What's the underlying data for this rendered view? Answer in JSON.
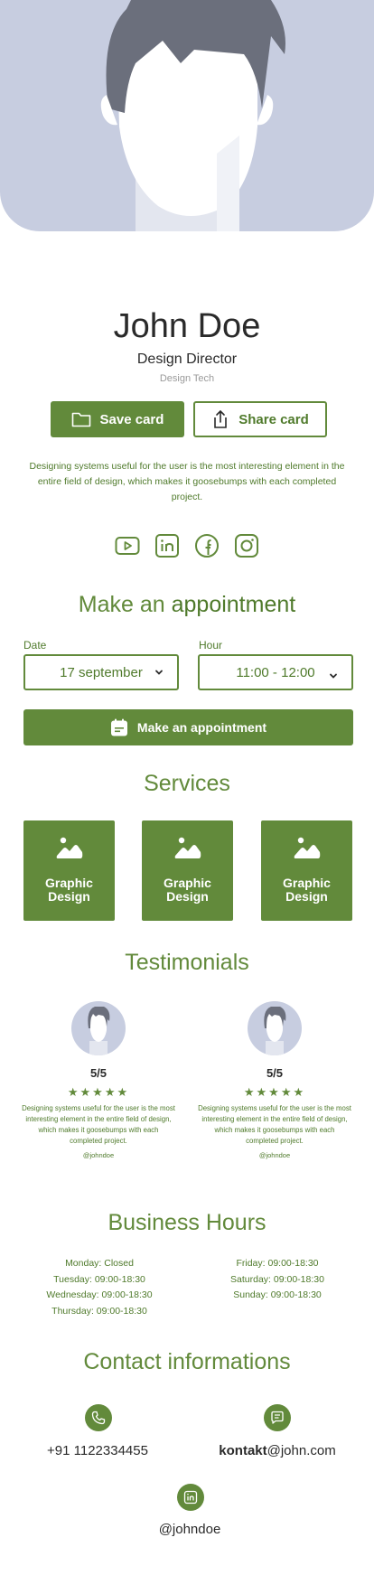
{
  "profile": {
    "name": "John Doe",
    "role": "Design Director",
    "company": "Design Tech",
    "bio": "Designing systems useful for the user is the most interesting element in the entire field of design, which makes it goosebumps with each completed project."
  },
  "actions": {
    "save_label": "Save card",
    "share_label": "Share card"
  },
  "socials": [
    "youtube-icon",
    "linkedin-icon",
    "facebook-icon",
    "instagram-icon"
  ],
  "appointment": {
    "heading_light": "Make an",
    "heading_bold": "appointment",
    "date_label": "Date",
    "date_value": "17 september",
    "hour_label": "Hour",
    "hour_value": "11:00 - 12:00",
    "button_label": "Make an appointment"
  },
  "services": {
    "heading": "Services",
    "items": [
      {
        "line1": "Graphic",
        "line2": "Design"
      },
      {
        "line1": "Graphic",
        "line2": "Design"
      },
      {
        "line1": "Graphic",
        "line2": "Design"
      }
    ]
  },
  "testimonials": {
    "heading": "Testimonials",
    "items": [
      {
        "score": "5/5",
        "stars": "★★★★★",
        "rating": 5,
        "text": "Designing systems useful for the user is the most interesting element in the entire field of design, which makes it goosebumps with each completed project.",
        "handle": "@johndoe"
      },
      {
        "score": "5/5",
        "stars": "★★★★★",
        "rating": 5,
        "text": "Designing systems useful for the user is the most interesting element in the entire field of design, which makes it goosebumps with each completed project.",
        "handle": "@johndoe"
      }
    ]
  },
  "hours": {
    "heading": "Business Hours",
    "left": [
      "Monday: Closed",
      "Tuesday: 09:00-18:30",
      "Wednesday: 09:00-18:30",
      "Thursday: 09:00-18:30"
    ],
    "right": [
      "Friday: 09:00-18:30",
      "Saturday: 09:00-18:30",
      "Sunday: 09:00-18:30"
    ]
  },
  "contact": {
    "heading": "Contact informations",
    "phone": "+91 1122334455",
    "email_bold": "kontakt",
    "email_rest": "@john.com",
    "linkedin": "@johndoe"
  },
  "colors": {
    "accent": "#628a3b",
    "accent_text": "#4f7a2b",
    "hero_bg": "#c7cde0"
  }
}
